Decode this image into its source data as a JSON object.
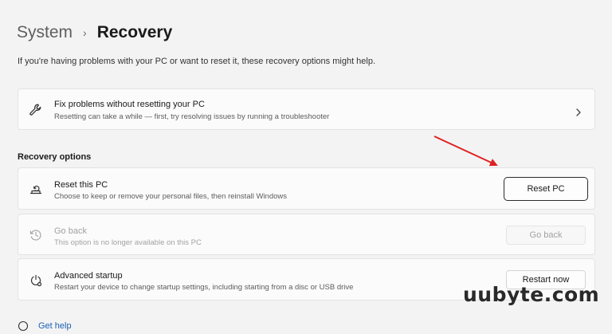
{
  "breadcrumb": {
    "parent": "System",
    "separator": "›",
    "current": "Recovery"
  },
  "description": "If you're having problems with your PC or want to reset it, these recovery options might help.",
  "fix_card": {
    "title": "Fix problems without resetting your PC",
    "subtitle": "Resetting can take a while — first, try resolving issues by running a troubleshooter",
    "icon": "wrench-icon"
  },
  "section": {
    "label": "Recovery options"
  },
  "options": [
    {
      "title": "Reset this PC",
      "subtitle": "Choose to keep or remove your personal files, then reinstall Windows",
      "button": "Reset PC",
      "icon": "reset-pc-icon",
      "enabled": true
    },
    {
      "title": "Go back",
      "subtitle": "This option is no longer available on this PC",
      "button": "Go back",
      "icon": "history-icon",
      "enabled": false
    },
    {
      "title": "Advanced startup",
      "subtitle": "Restart your device to change startup settings, including starting from a disc or USB drive",
      "button": "Restart now",
      "icon": "advanced-startup-icon",
      "enabled": true
    }
  ],
  "footer": {
    "get_help": "Get help"
  },
  "watermark": "uubyte.com",
  "colors": {
    "arrow": "#e02020",
    "background": "#f3f3f3",
    "card": "#fbfbfb",
    "link": "#1a62b4"
  }
}
